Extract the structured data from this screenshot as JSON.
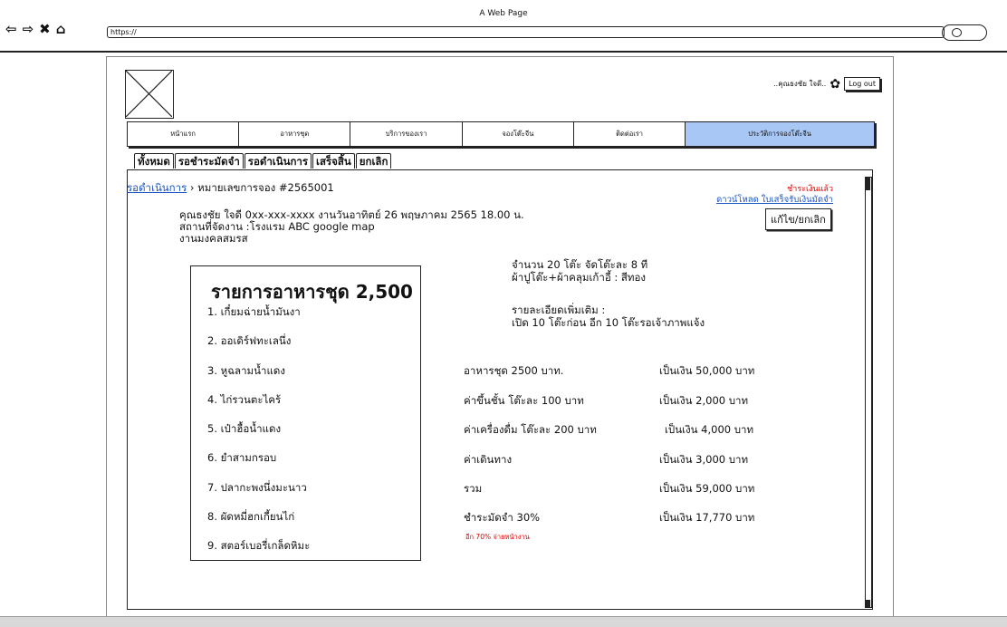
{
  "window": {
    "title": "A Web Page",
    "url": "https://"
  },
  "user": {
    "name": "..คุณธงชัย ใจดี..",
    "logout_label": "Log out"
  },
  "topnav": [
    "หน้าแรก",
    "อาหารชุด",
    "บริการของเรา",
    "จองโต๊ะจีน",
    "ติดต่อเรา",
    "ประวัติการจองโต๊ะจีน"
  ],
  "tabs": [
    "ทั้งหมด",
    "รอชำระมัดจำ",
    "รอดำเนินการ",
    "เสร็จสิ้น",
    "ยกเลิก"
  ],
  "breadcrumb": {
    "link": "รอดำเนินการ",
    "current": "› หมายเลขการจอง #2565001"
  },
  "status": {
    "paid": "ชำระเงินแล้ว",
    "download": "ดาวน์โหลด ใบเสร็จรับเงินมัดจำ",
    "edit": "แก้ไข/ยกเลิก"
  },
  "booking": {
    "line1": "คุณธงชัย ใจดี 0xx-xxx-xxxx งานวันอาทิตย์ 26 พฤษภาคม 2565 18.00 น.",
    "line2": "สถานที่จัดงาน :โรงแรม ABC google map",
    "line3": "งานมงคลสมรส"
  },
  "menu": {
    "title": "รายการอาหารชุด 2,500",
    "items": [
      "1. เกี๋ยมฉ่ายน้ำมันงา",
      "2. ออเดิร์ฟทะเลนึ่ง",
      "3. หูฉลามน้ำแดง",
      "4. ไก่รวนตะไคร้",
      "5. เป๋าฮื้อน้ำแดง",
      "6. ยำสามกรอบ",
      "7. ปลากะพงนึ่งมะนาว",
      "8. ผัดหมี่ฮกเกี้ยนไก่",
      "9. สตอร์เบอรี่เกล็ดหิมะ"
    ]
  },
  "details": {
    "tables": "จำนวน 20 โต๊ะ จัดโต๊ะละ 8 ที",
    "cloth": "ผ้าปูโต๊ะ+ผ้าคลุมเก้าอี้ : สีทอง",
    "more_title": "รายละเอียดเพิ่มเติม :",
    "more_text": "เปิด 10 โต๊ะก่อน อีก 10 โต๊ะรอเจ้าภาพแจ้ง"
  },
  "costs": [
    {
      "label": "อาหารชุด 2500 บาท.",
      "amount": "เป็นเงิน 50,000 บาท"
    },
    {
      "label": "ค่าขึ้นชั้น โต๊ะละ 100 บาท",
      "amount": "เป็นเงิน 2,000 บาท"
    },
    {
      "label": "ค่าเครื่องดื่ม โต๊ะละ 200 บาท",
      "amount": "เป็นเงิน 4,000 บาท"
    },
    {
      "label": "ค่าเดินทาง",
      "amount": "เป็นเงิน 3,000 บาท"
    },
    {
      "label": "รวม",
      "amount": "เป็นเงิน 59,000 บาท"
    },
    {
      "label": "ชำระมัดจำ 30%",
      "amount": "เป็นเงิน 17,770 บาท"
    }
  ],
  "remaining_note": "อีก 70% จ่ายหน้างาน",
  "icons": {
    "back": "arrow-left-icon",
    "forward": "arrow-right-icon",
    "stop": "close-icon",
    "home": "home-icon",
    "gear": "gear-icon",
    "search": "search-icon"
  },
  "colors": {
    "nav_highlight": "#a9c7f5",
    "link": "#1a56c2",
    "alert": "#dd0000"
  }
}
